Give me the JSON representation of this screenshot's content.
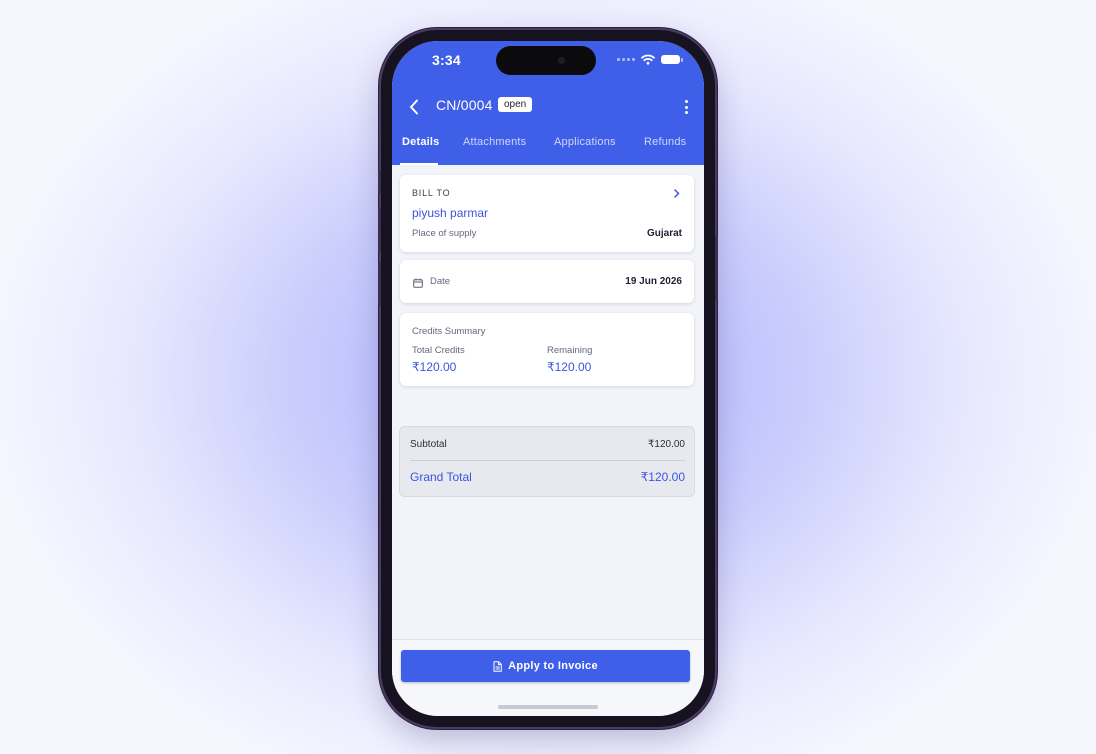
{
  "status_bar": {
    "time": "3:34"
  },
  "header": {
    "title": "CN/0004",
    "status_badge": "open",
    "back_icon": "chevron-left-icon",
    "more_icon": "more-vertical-icon"
  },
  "tabs": [
    {
      "label": "Details",
      "active": true
    },
    {
      "label": "Attachments",
      "active": false
    },
    {
      "label": "Applications",
      "active": false
    },
    {
      "label": "Refunds",
      "active": false
    }
  ],
  "bill_to": {
    "heading": "BILL TO",
    "customer": "piyush parmar",
    "place_label": "Place of supply",
    "place_value": "Gujarat"
  },
  "date_row": {
    "label": "Date",
    "value": "19 Jun 2026"
  },
  "credits": {
    "heading": "Credits Summary",
    "total_label": "Total Credits",
    "total_value": "₹120.00",
    "remaining_label": "Remaining",
    "remaining_value": "₹120.00"
  },
  "totals": {
    "subtotal_label": "Subtotal",
    "subtotal_value": "₹120.00",
    "grand_label": "Grand Total",
    "grand_value": "₹120.00"
  },
  "footer": {
    "apply_label": "Apply to Invoice"
  },
  "colors": {
    "primary": "#3f5fe8",
    "background": "#f2f4f9",
    "accent_text": "#3a55e0"
  }
}
